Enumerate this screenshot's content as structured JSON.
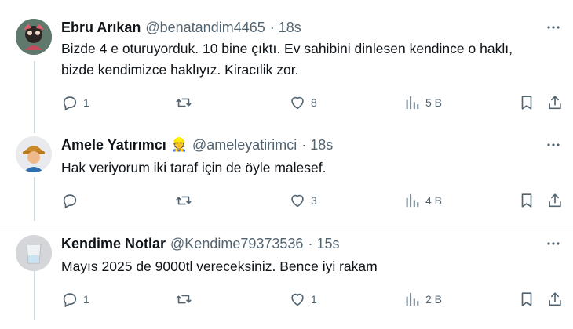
{
  "tweets": [
    {
      "name": "Ebru Arıkan",
      "handle": "@benatandim4465",
      "time": "· 18s",
      "emoji": "",
      "lines": [
        "Bizde 4 e oturuyorduk. 10 bine çıktı. Ev sahibini dinlesen kendince o haklı,",
        "bizde kendimizce haklıyız. Kiracılik zor."
      ],
      "replies": "1",
      "retweets": "",
      "likes": "8",
      "views": "5 B"
    },
    {
      "name": "Amele Yatırımcı",
      "handle": "@ameleyatirimci",
      "time": "· 18s",
      "emoji": "👷",
      "lines": [
        "Hak veriyorum iki taraf için de öyle malesef."
      ],
      "replies": "",
      "retweets": "",
      "likes": "3",
      "views": "4 B"
    },
    {
      "name": "Kendime Notlar",
      "handle": "@Kendime79373536",
      "time": "· 15s",
      "emoji": "",
      "lines": [
        "Mayıs 2025 de 9000tl vereceksiniz. Bence iyi rakam"
      ],
      "replies": "1",
      "retweets": "",
      "likes": "1",
      "views": "2 B"
    }
  ],
  "icons": {
    "reply": "reply-icon",
    "retweet": "retweet-icon",
    "like": "heart-icon",
    "views": "views-chart-icon",
    "bookmark": "bookmark-icon",
    "share": "share-icon",
    "more": "more-dots-icon"
  },
  "colors": {
    "text": "#0f1419",
    "muted": "#536471",
    "line": "#cfd9de",
    "separator": "#eff3f4"
  }
}
